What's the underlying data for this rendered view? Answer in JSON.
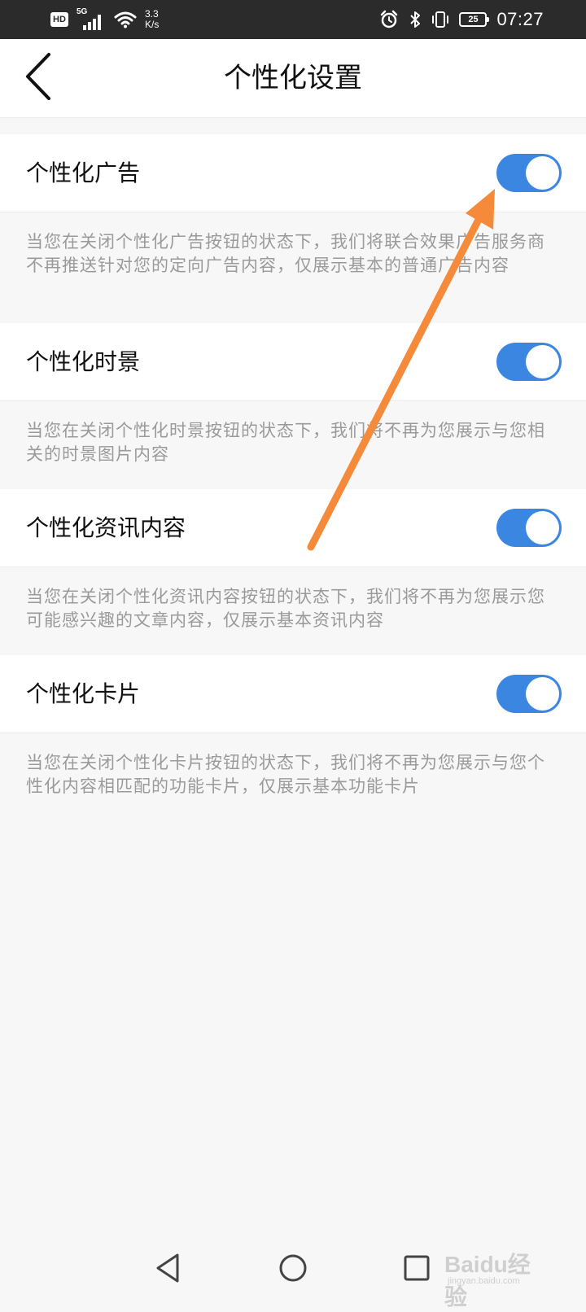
{
  "status_bar": {
    "hd_label": "HD",
    "network_label": "5G",
    "speed_value": "3.3",
    "speed_unit": "K/s",
    "battery_level": "25",
    "time": "07:27"
  },
  "header": {
    "title": "个性化设置"
  },
  "settings": [
    {
      "label": "个性化广告",
      "enabled": true,
      "description": "当您在关闭个性化广告按钮的状态下，我们将联合效果广告服务商不再推送针对您的定向广告内容，仅展示基本的普通广告内容"
    },
    {
      "label": "个性化时景",
      "enabled": true,
      "description": "当您在关闭个性化时景按钮的状态下，我们将不再为您展示与您相关的时景图片内容"
    },
    {
      "label": "个性化资讯内容",
      "enabled": true,
      "description": "当您在关闭个性化资讯内容按钮的状态下，我们将不再为您展示您可能感兴趣的文章内容，仅展示基本资讯内容"
    },
    {
      "label": "个性化卡片",
      "enabled": true,
      "description": "当您在关闭个性化卡片按钮的状态下，我们将不再为您展示与您个性化内容相匹配的功能卡片，仅展示基本功能卡片"
    }
  ],
  "colors": {
    "toggle_on": "#3a86e0",
    "annotation_arrow": "#f58a3a",
    "status_bar_bg": "#2b2b2b"
  },
  "icons": {
    "back": "chevron-left-icon",
    "nav_back": "triangle-back-icon",
    "nav_home": "circle-home-icon",
    "nav_recent": "square-recent-icon"
  },
  "watermark": {
    "main": "Baidu经验",
    "sub": "jingyan.baidu.com"
  }
}
